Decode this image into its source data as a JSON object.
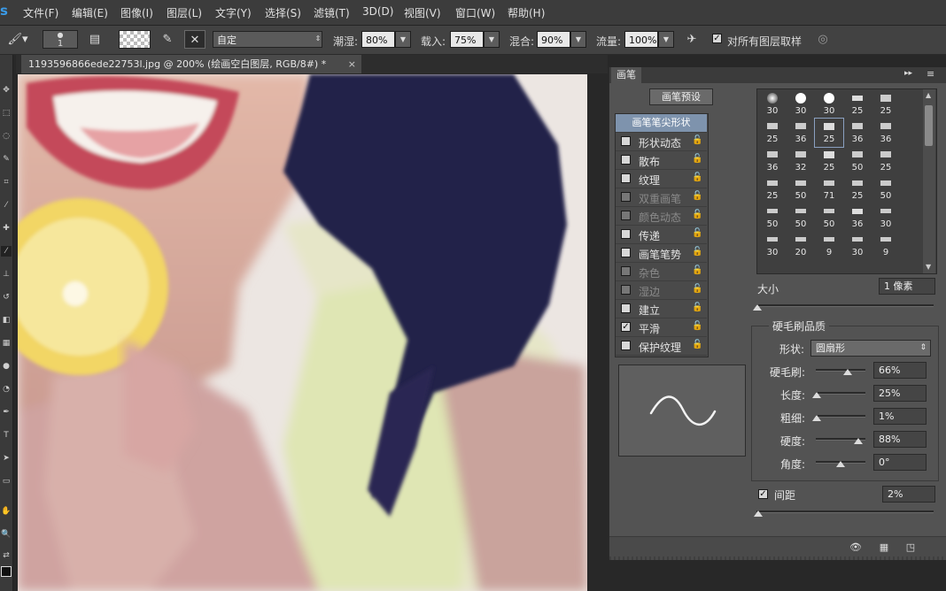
{
  "menubar": {
    "logo": "s",
    "items": [
      "文件(F)",
      "编辑(E)",
      "图像(I)",
      "图层(L)",
      "文字(Y)",
      "选择(S)",
      "滤镜(T)",
      "3D(D)",
      "视图(V)",
      "窗口(W)",
      "帮助(H)"
    ]
  },
  "options": {
    "brush_size": "1",
    "mode_value": "自定",
    "wet_label": "潮湿:",
    "wet_value": "80%",
    "load_label": "载入:",
    "load_value": "75%",
    "mix_label": "混合:",
    "mix_value": "90%",
    "flow_label": "流量:",
    "flow_value": "100%",
    "sample_all_label": "对所有图层取样",
    "sample_all_checked": "✓"
  },
  "document": {
    "tab_title": "1193596866ede22753l.jpg @ 200% (绘画空白图层, RGB/8#) *",
    "close": "×"
  },
  "brush_panel": {
    "tab": "画笔",
    "presets_button": "画笔预设",
    "collapse_icon": "▸▸",
    "menu_icon": "≡",
    "options": [
      {
        "label": "画笔笔尖形状",
        "header": true
      },
      {
        "label": "形状动态",
        "checked": "",
        "enabled": true
      },
      {
        "label": "散布",
        "checked": "",
        "enabled": true
      },
      {
        "label": "纹理",
        "checked": "",
        "enabled": true
      },
      {
        "label": "双重画笔",
        "checked": "",
        "enabled": false
      },
      {
        "label": "颜色动态",
        "checked": "",
        "enabled": false
      },
      {
        "label": "传递",
        "checked": "",
        "enabled": true
      },
      {
        "label": "画笔笔势",
        "checked": "",
        "enabled": true
      },
      {
        "label": "杂色",
        "checked": "",
        "enabled": false
      },
      {
        "label": "湿边",
        "checked": "",
        "enabled": false
      },
      {
        "label": "建立",
        "checked": "",
        "enabled": true
      },
      {
        "label": "平滑",
        "checked": "✓",
        "enabled": true
      },
      {
        "label": "保护纹理",
        "checked": "",
        "enabled": true
      }
    ],
    "tips": [
      [
        "30",
        "30",
        "30",
        "25",
        "25"
      ],
      [
        "25",
        "36",
        "25",
        "36",
        "36"
      ],
      [
        "36",
        "32",
        "25",
        "50",
        "25"
      ],
      [
        "25",
        "50",
        "71",
        "25",
        "50"
      ],
      [
        "50",
        "50",
        "50",
        "36",
        "30"
      ],
      [
        "30",
        "20",
        "9",
        "30",
        "9"
      ]
    ],
    "size_label": "大小",
    "size_value": "1 像素",
    "bristle_title": "硬毛刷品质",
    "shape_label": "形状:",
    "shape_value": "圆扇形",
    "bristles_label": "硬毛刷:",
    "bristles_value": "66%",
    "length_label": "长度:",
    "length_value": "25%",
    "thickness_label": "粗细:",
    "thickness_value": "1%",
    "stiffness_label": "硬度:",
    "stiffness_value": "88%",
    "angle_label": "角度:",
    "angle_value": "0°",
    "spacing_label": "间距",
    "spacing_checked": "✓",
    "spacing_value": "2%"
  }
}
